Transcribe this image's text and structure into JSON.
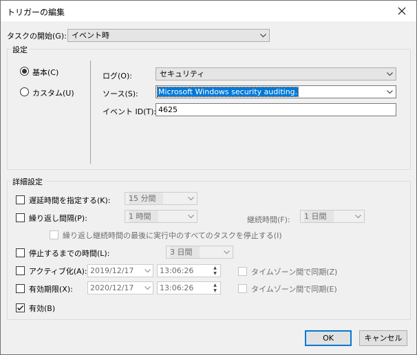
{
  "window": {
    "title": "トリガーの編集"
  },
  "start": {
    "label": "タスクの開始(G):",
    "value": "イベント時"
  },
  "settings": {
    "group_title": "設定",
    "radio_basic": "基本(C)",
    "radio_custom": "カスタム(U)",
    "log_label": "ログ(O):",
    "log_value": "セキュリティ",
    "source_label": "ソース(S):",
    "source_value": "Microsoft Windows security auditing.",
    "eventid_label": "イベント ID(T):",
    "eventid_value": "4625"
  },
  "advanced": {
    "group_title": "詳細設定",
    "delay_label": "遅延時間を指定する(K):",
    "delay_value": "15 分間",
    "repeat_label": "繰り返し間隔(P):",
    "repeat_value": "1 時間",
    "duration_label": "継続時間(F):",
    "duration_value": "1 日間",
    "stop_repeat_label": "繰り返し継続時間の最後に実行中のすべてのタスクを停止する(I)",
    "stop_after_label": "停止するまでの時間(L):",
    "stop_after_value": "3 日間",
    "activate_label": "アクティブ化(A):",
    "activate_date": "2019/12/17",
    "activate_time": "13:06:26",
    "activate_sync": "タイムゾーン間で同期(Z)",
    "expire_label": "有効期限(X):",
    "expire_date": "2020/12/17",
    "expire_time": "13:06:26",
    "expire_sync": "タイムゾーン間で同期(E)",
    "enabled_label": "有効(B)"
  },
  "buttons": {
    "ok": "OK",
    "cancel": "キャンセル"
  },
  "icons": {
    "close": "close-icon",
    "dropdown": "chevron-down-icon",
    "check": "checkmark-icon"
  }
}
